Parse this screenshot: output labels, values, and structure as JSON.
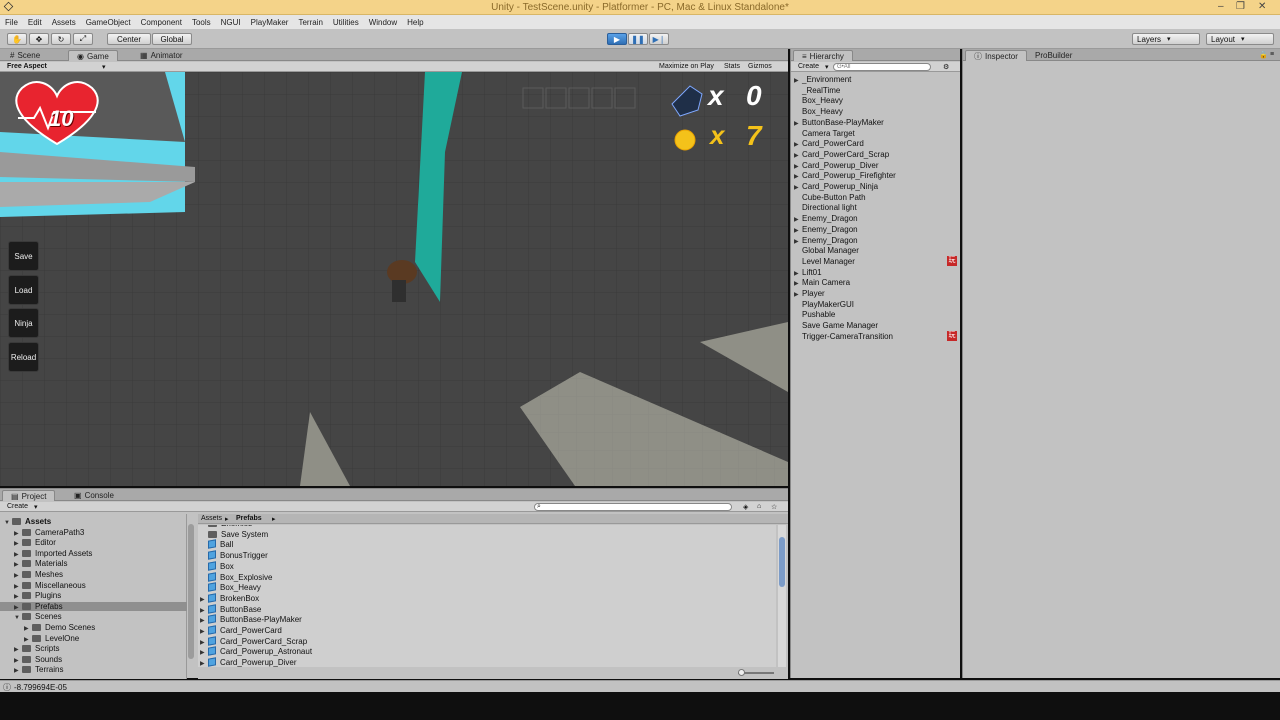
{
  "window": {
    "title": "Unity - TestScene.unity - Platformer - PC, Mac & Linux Standalone*"
  },
  "menu": [
    "File",
    "Edit",
    "Assets",
    "GameObject",
    "Component",
    "Tools",
    "NGUI",
    "PlayMaker",
    "Terrain",
    "Utilities",
    "Window",
    "Help"
  ],
  "toolbar": {
    "pivot": "Center",
    "space": "Global",
    "layers": "Layers",
    "layout": "Layout"
  },
  "view_tabs": [
    "Scene",
    "Game",
    "Animator"
  ],
  "game_bar": {
    "aspect": "Free Aspect",
    "maximize": "Maximize on Play",
    "stats": "Stats",
    "gizmos": "Gizmos"
  },
  "hud": {
    "health": "10",
    "blocks_x": "x",
    "blocks_count": "0",
    "coins_x": "x",
    "coins_count": "7",
    "buttons": [
      "Save",
      "Load",
      "Ninja",
      "Reload"
    ]
  },
  "hierarchy": {
    "tab": "Hierarchy",
    "create": "Create",
    "search_placeholder": "G•All",
    "items": [
      {
        "label": "_Environment",
        "arrow": true
      },
      {
        "label": "_RealTime",
        "arrow": false
      },
      {
        "label": "Box_Heavy",
        "arrow": false
      },
      {
        "label": "Box_Heavy",
        "arrow": false
      },
      {
        "label": "ButtonBase-PlayMaker",
        "arrow": true
      },
      {
        "label": "Camera Target",
        "arrow": false
      },
      {
        "label": "Card_PowerCard",
        "arrow": true
      },
      {
        "label": "Card_PowerCard_Scrap",
        "arrow": true
      },
      {
        "label": "Card_Powerup_Diver",
        "arrow": true
      },
      {
        "label": "Card_Powerup_Firefighter",
        "arrow": true
      },
      {
        "label": "Card_Powerup_Ninja",
        "arrow": true
      },
      {
        "label": "Cube-Button Path",
        "arrow": false
      },
      {
        "label": "Directional light",
        "arrow": false
      },
      {
        "label": "Enemy_Dragon",
        "arrow": true
      },
      {
        "label": "Enemy_Dragon",
        "arrow": true
      },
      {
        "label": "Enemy_Dragon",
        "arrow": true
      },
      {
        "label": "Global Manager",
        "arrow": false
      },
      {
        "label": "Level Manager",
        "arrow": false
      },
      {
        "label": "Lift01",
        "arrow": true
      },
      {
        "label": "Main Camera",
        "arrow": true
      },
      {
        "label": "Player",
        "arrow": true
      },
      {
        "label": "PlayMakerGUI",
        "arrow": false
      },
      {
        "label": "Pushable",
        "arrow": false
      },
      {
        "label": "Save Game Manager",
        "arrow": false
      },
      {
        "label": "Trigger-CameraTransition",
        "arrow": false
      }
    ],
    "badge": "玩"
  },
  "inspector": {
    "tabs": [
      "Inspector",
      "ProBuilder"
    ]
  },
  "project": {
    "tabs": [
      "Project",
      "Console"
    ],
    "create": "Create",
    "breadcrumb_root": "Assets",
    "breadcrumb_current": "Prefabs",
    "folders": [
      {
        "label": "Assets",
        "depth": 0,
        "open": true
      },
      {
        "label": "CameraPath3",
        "depth": 1
      },
      {
        "label": "Editor",
        "depth": 1
      },
      {
        "label": "Imported Assets",
        "depth": 1
      },
      {
        "label": "Materials",
        "depth": 1
      },
      {
        "label": "Meshes",
        "depth": 1
      },
      {
        "label": "Miscellaneous",
        "depth": 1
      },
      {
        "label": "Plugins",
        "depth": 1
      },
      {
        "label": "Prefabs",
        "depth": 1,
        "selected": true
      },
      {
        "label": "Scenes",
        "depth": 1,
        "open": true
      },
      {
        "label": "Demo Scenes",
        "depth": 2
      },
      {
        "label": "LevelOne",
        "depth": 2
      },
      {
        "label": "Scripts",
        "depth": 1
      },
      {
        "label": "Sounds",
        "depth": 1
      },
      {
        "label": "Terrains",
        "depth": 1
      }
    ],
    "assets": [
      {
        "label": "Enemies",
        "kind": "folder",
        "arrow": false
      },
      {
        "label": "Save System",
        "kind": "folder",
        "arrow": false
      },
      {
        "label": "Ball",
        "kind": "prefab",
        "arrow": false
      },
      {
        "label": "BonusTrigger",
        "kind": "prefab",
        "arrow": false
      },
      {
        "label": "Box",
        "kind": "prefab",
        "arrow": false
      },
      {
        "label": "Box_Explosive",
        "kind": "prefab",
        "arrow": false
      },
      {
        "label": "Box_Heavy",
        "kind": "prefab",
        "arrow": false
      },
      {
        "label": "BrokenBox",
        "kind": "prefab",
        "arrow": true
      },
      {
        "label": "ButtonBase",
        "kind": "prefab",
        "arrow": true
      },
      {
        "label": "ButtonBase-PlayMaker",
        "kind": "prefab",
        "arrow": true
      },
      {
        "label": "Card_PowerCard",
        "kind": "prefab",
        "arrow": true
      },
      {
        "label": "Card_PowerCard_Scrap",
        "kind": "prefab",
        "arrow": true
      },
      {
        "label": "Card_Powerup_Astronaut",
        "kind": "prefab",
        "arrow": true
      },
      {
        "label": "Card_Powerup_Diver",
        "kind": "prefab",
        "arrow": true
      }
    ]
  },
  "status": {
    "message": "-8.799694E-05"
  },
  "colors": {
    "accent": "#2f6fb5",
    "titlebar": "#f4d389",
    "panel": "#c2c2c2",
    "selected": "#8f8f8f"
  }
}
